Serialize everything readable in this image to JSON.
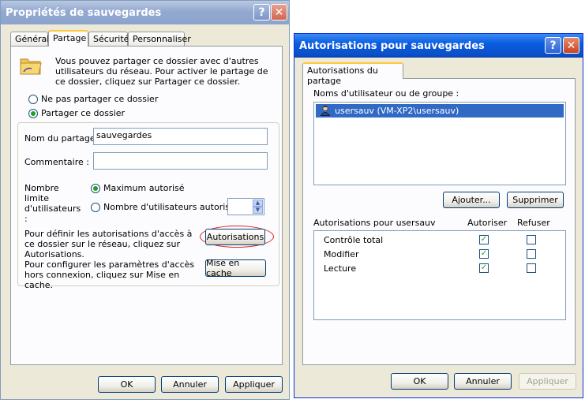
{
  "window1": {
    "title": "Propriétés de sauvegardes",
    "help_btn": "?",
    "close_btn": "✕",
    "tabs": [
      {
        "label": "Général"
      },
      {
        "label": "Partage"
      },
      {
        "label": "Sécurité"
      },
      {
        "label": "Personnaliser"
      }
    ],
    "intro_text": "Vous pouvez partager ce dossier avec d'autres utilisateurs du réseau. Pour activer le partage de ce dossier, cliquez sur Partager ce dossier.",
    "radio_no_share": "Ne pas partager ce dossier",
    "radio_share": "Partager ce dossier",
    "share_name_label": "Nom du partage :",
    "share_name_value": "sauvegardes",
    "comment_label": "Commentaire :",
    "comment_value": "",
    "user_limit_label": "Nombre limite d'utilisateurs :",
    "radio_max": "Maximum autorisé",
    "radio_count": "Nombre d'utilisateurs autorisés :",
    "permissions_text": "Pour définir les autorisations d'accès à ce dossier sur le réseau, cliquez sur Autorisations.",
    "permissions_btn": "Autorisations",
    "offline_text": "Pour configurer les paramètres d'accès hors connexion, cliquez sur Mise en cache.",
    "cache_btn": "Mise en cache",
    "ok": "OK",
    "cancel": "Annuler",
    "apply": "Appliquer"
  },
  "window2": {
    "title": "Autorisations pour sauvegardes",
    "help_btn": "?",
    "close_btn": "✕",
    "tab": "Autorisations du partage",
    "group_label": "Noms d'utilisateur ou de groupe :",
    "users": [
      {
        "name": "usersauv (VM-XP2\\usersauv)"
      }
    ],
    "add_btn": "Ajouter...",
    "remove_btn": "Supprimer",
    "perm_header": "Autorisations pour usersauv",
    "allow_header": "Autoriser",
    "deny_header": "Refuser",
    "permissions": [
      {
        "name": "Contrôle total",
        "allow": true,
        "deny": false
      },
      {
        "name": "Modifier",
        "allow": true,
        "deny": false
      },
      {
        "name": "Lecture",
        "allow": true,
        "deny": false
      }
    ],
    "ok": "OK",
    "cancel": "Annuler",
    "apply": "Appliquer"
  }
}
